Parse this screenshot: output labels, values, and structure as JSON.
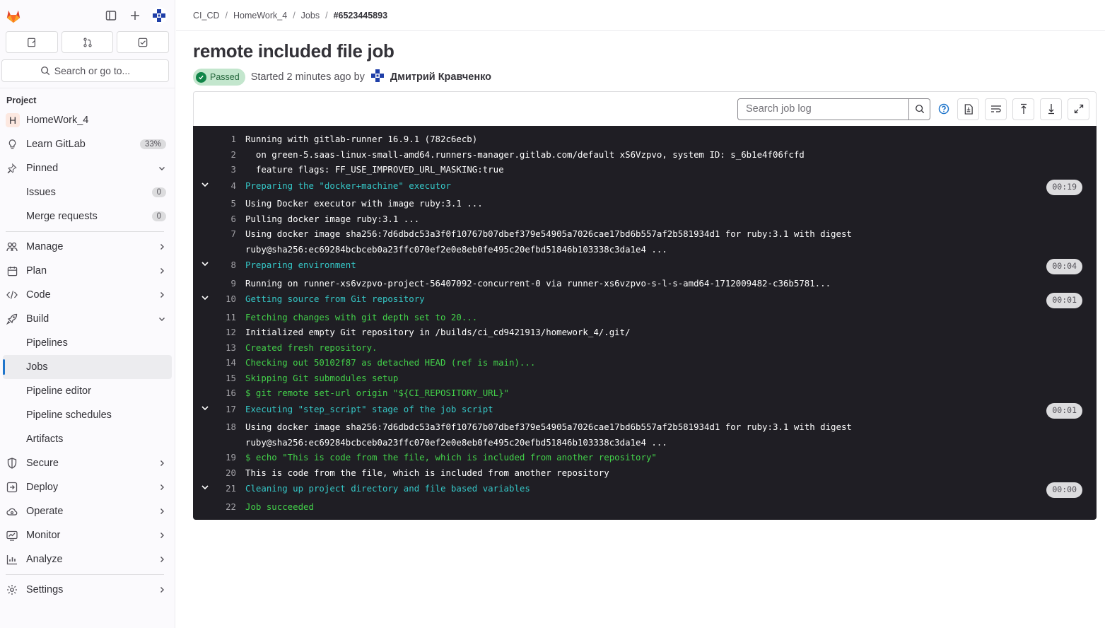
{
  "sidebar": {
    "search_placeholder": "Search or go to...",
    "section_heading": "Project",
    "project_initial": "H",
    "project_name": "HomeWork_4",
    "learn_label": "Learn GitLab",
    "learn_progress": "33%",
    "pinned_label": "Pinned",
    "issues_label": "Issues",
    "issues_count": "0",
    "mr_label": "Merge requests",
    "mr_count": "0",
    "manage": "Manage",
    "plan": "Plan",
    "code": "Code",
    "build": "Build",
    "pipelines": "Pipelines",
    "jobs": "Jobs",
    "pipeline_editor": "Pipeline editor",
    "pipeline_schedules": "Pipeline schedules",
    "artifacts": "Artifacts",
    "secure": "Secure",
    "deploy": "Deploy",
    "operate": "Operate",
    "monitor": "Monitor",
    "analyze": "Analyze",
    "settings": "Settings"
  },
  "breadcrumb": [
    "CI_CD",
    "HomeWork_4",
    "Jobs",
    "#6523445893"
  ],
  "job": {
    "title": "remote included file job",
    "status": "Passed",
    "started": "Started 2 minutes ago by",
    "author": "Дмитрий Кравченко"
  },
  "toolbar": {
    "search_placeholder": "Search job log"
  },
  "log": [
    {
      "n": "1",
      "text": "Running with gitlab-runner 16.9.1 (782c6ecb)",
      "color": "white"
    },
    {
      "n": "2",
      "text": "  on green-5.saas-linux-small-amd64.runners-manager.gitlab.com/default xS6Vzpvo, system ID: s_6b1e4f06fcfd",
      "color": "white"
    },
    {
      "n": "3",
      "text": "  feature flags: FF_USE_IMPROVED_URL_MASKING:true",
      "color": "white"
    },
    {
      "n": "4",
      "text": "Preparing the \"docker+machine\" executor",
      "color": "cyan",
      "section": true,
      "duration": "00:19"
    },
    {
      "n": "5",
      "text": "Using Docker executor with image ruby:3.1 ...",
      "color": "white"
    },
    {
      "n": "6",
      "text": "Pulling docker image ruby:3.1 ...",
      "color": "white"
    },
    {
      "n": "7",
      "text": "Using docker image sha256:7d6dbdc53a3f0f10767b07dbef379e54905a7026cae17bd6b557af2b581934d1 for ruby:3.1 with digest ruby@sha256:ec69284bcbceb0a23ffc070ef2e0e8eb0fe495c20efbd51846b103338c3da1e4 ...",
      "color": "white"
    },
    {
      "n": "8",
      "text": "Preparing environment",
      "color": "cyan",
      "section": true,
      "duration": "00:04"
    },
    {
      "n": "9",
      "text": "Running on runner-xs6vzpvo-project-56407092-concurrent-0 via runner-xs6vzpvo-s-l-s-amd64-1712009482-c36b5781...",
      "color": "white"
    },
    {
      "n": "10",
      "text": "Getting source from Git repository",
      "color": "cyan",
      "section": true,
      "duration": "00:01"
    },
    {
      "n": "11",
      "text": "Fetching changes with git depth set to 20...",
      "color": "green"
    },
    {
      "n": "12",
      "text": "Initialized empty Git repository in /builds/ci_cd9421913/homework_4/.git/",
      "color": "white"
    },
    {
      "n": "13",
      "text": "Created fresh repository.",
      "color": "green"
    },
    {
      "n": "14",
      "text": "Checking out 50102f87 as detached HEAD (ref is main)...",
      "color": "green"
    },
    {
      "n": "15",
      "text": "Skipping Git submodules setup",
      "color": "green"
    },
    {
      "n": "16",
      "text": "$ git remote set-url origin \"${CI_REPOSITORY_URL}\"",
      "color": "green"
    },
    {
      "n": "17",
      "text": "Executing \"step_script\" stage of the job script",
      "color": "cyan",
      "section": true,
      "duration": "00:01"
    },
    {
      "n": "18",
      "text": "Using docker image sha256:7d6dbdc53a3f0f10767b07dbef379e54905a7026cae17bd6b557af2b581934d1 for ruby:3.1 with digest ruby@sha256:ec69284bcbceb0a23ffc070ef2e0e8eb0fe495c20efbd51846b103338c3da1e4 ...",
      "color": "white"
    },
    {
      "n": "19",
      "text": "$ echo \"This is code from the file, which is included from another repository\"",
      "color": "green"
    },
    {
      "n": "20",
      "text": "This is code from the file, which is included from another repository",
      "color": "white"
    },
    {
      "n": "21",
      "text": "Cleaning up project directory and file based variables",
      "color": "cyan",
      "section": true,
      "duration": "00:00"
    },
    {
      "n": "22",
      "text": "Job succeeded",
      "color": "green"
    }
  ]
}
